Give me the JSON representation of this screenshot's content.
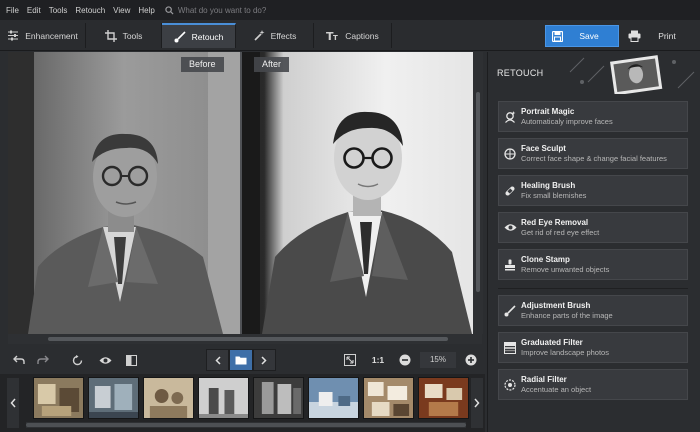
{
  "menu": {
    "items": [
      "File",
      "Edit",
      "Tools",
      "Retouch",
      "View",
      "Help"
    ],
    "search_placeholder": "What do you want to do?"
  },
  "toolbar": {
    "tabs": [
      {
        "label": "Enhancement",
        "icon": "sliders-icon"
      },
      {
        "label": "Tools",
        "icon": "crop-icon"
      },
      {
        "label": "Retouch",
        "icon": "brush-icon",
        "active": true
      },
      {
        "label": "Effects",
        "icon": "magic-wand-icon"
      },
      {
        "label": "Captions",
        "icon": "text-icon"
      }
    ],
    "save_label": "Save",
    "print_label": "Print"
  },
  "canvas": {
    "before_label": "Before",
    "after_label": "After"
  },
  "controls": {
    "one_to_one": "1:1",
    "zoom": "15%"
  },
  "panel": {
    "title": "RETOUCH",
    "tools": [
      {
        "title": "Portrait Magic",
        "desc": "Automaticaly improve faces",
        "icon": "portrait-magic-icon"
      },
      {
        "title": "Face Sculpt",
        "desc": "Correct face shape & change facial features",
        "icon": "face-sculpt-icon"
      },
      {
        "title": "Healing Brush",
        "desc": "Fix small blemishes",
        "icon": "bandage-icon"
      },
      {
        "title": "Red Eye Removal",
        "desc": "Get rid of red eye effect",
        "icon": "eye-icon"
      },
      {
        "title": "Clone Stamp",
        "desc": "Remove unwanted objects",
        "icon": "stamp-icon"
      },
      {
        "title": "Adjustment Brush",
        "desc": "Enhance parts of the image",
        "icon": "brush-icon"
      },
      {
        "title": "Graduated Filter",
        "desc": "Improve landscape photos",
        "icon": "gradient-icon"
      },
      {
        "title": "Radial Filter",
        "desc": "Accentuate an object",
        "icon": "radial-icon"
      }
    ]
  },
  "colors": {
    "accent": "#2f7fd3",
    "panel_bg": "#2b2d30",
    "card_bg": "#383a3e"
  }
}
